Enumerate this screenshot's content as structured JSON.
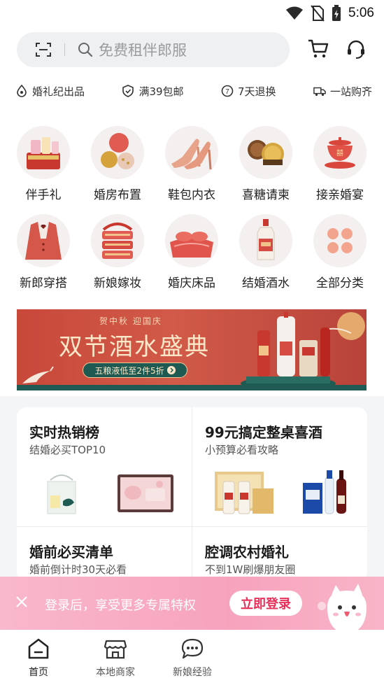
{
  "status_bar": {
    "time": "5:06"
  },
  "search": {
    "placeholder": "免费租伴郎服"
  },
  "features": [
    {
      "label": "婚礼纪出品",
      "icon": "drop-logo-icon"
    },
    {
      "label": "满39包邮",
      "icon": "shield-check-icon"
    },
    {
      "label": "7天退换",
      "icon": "seven-days-icon"
    },
    {
      "label": "一站购齐",
      "icon": "truck-icon"
    }
  ],
  "categories": [
    {
      "label": "伴手礼",
      "icon": "gift-box-icon"
    },
    {
      "label": "婚房布置",
      "icon": "balloons-icon"
    },
    {
      "label": "鞋包内衣",
      "icon": "high-heels-icon"
    },
    {
      "label": "喜糖请柬",
      "icon": "chocolates-icon"
    },
    {
      "label": "接亲婚宴",
      "icon": "tea-cup-icon"
    },
    {
      "label": "新郎穿搭",
      "icon": "suit-icon"
    },
    {
      "label": "新娘嫁妆",
      "icon": "basket-icon"
    },
    {
      "label": "婚庆床品",
      "icon": "bedding-icon"
    },
    {
      "label": "结婚酒水",
      "icon": "liquor-bottle-icon"
    },
    {
      "label": "全部分类",
      "icon": "all-categories-icon"
    }
  ],
  "banner": {
    "subtitle": "贺中秋  迎国庆",
    "title": "双节酒水盛典",
    "pill": "五粮液低至2件5折"
  },
  "cards": [
    {
      "title": "实时热销榜",
      "subtitle": "结婚必买TOP10"
    },
    {
      "title": "99元搞定整桌喜酒",
      "subtitle": "小预算必看攻略"
    },
    {
      "title": "婚前必买清单",
      "subtitle": "婚前倒计时30天必看"
    },
    {
      "title": "腔调农村婚礼",
      "subtitle": "不到1W刷爆朋友圈"
    }
  ],
  "login_banner": {
    "text": "登录后，享受更多专属特权",
    "button": "立即登录"
  },
  "bottom_nav": [
    {
      "label": "首页",
      "icon": "home-icon",
      "active": true
    },
    {
      "label": "本地商家",
      "icon": "store-icon",
      "active": false
    },
    {
      "label": "新娘经验",
      "icon": "chat-bubble-icon",
      "active": false
    }
  ],
  "colors": {
    "accent": "#e6305a",
    "banner_red": "#c8483a",
    "login_pink": "#f7a3bd",
    "search_bg": "#eef0f2"
  }
}
